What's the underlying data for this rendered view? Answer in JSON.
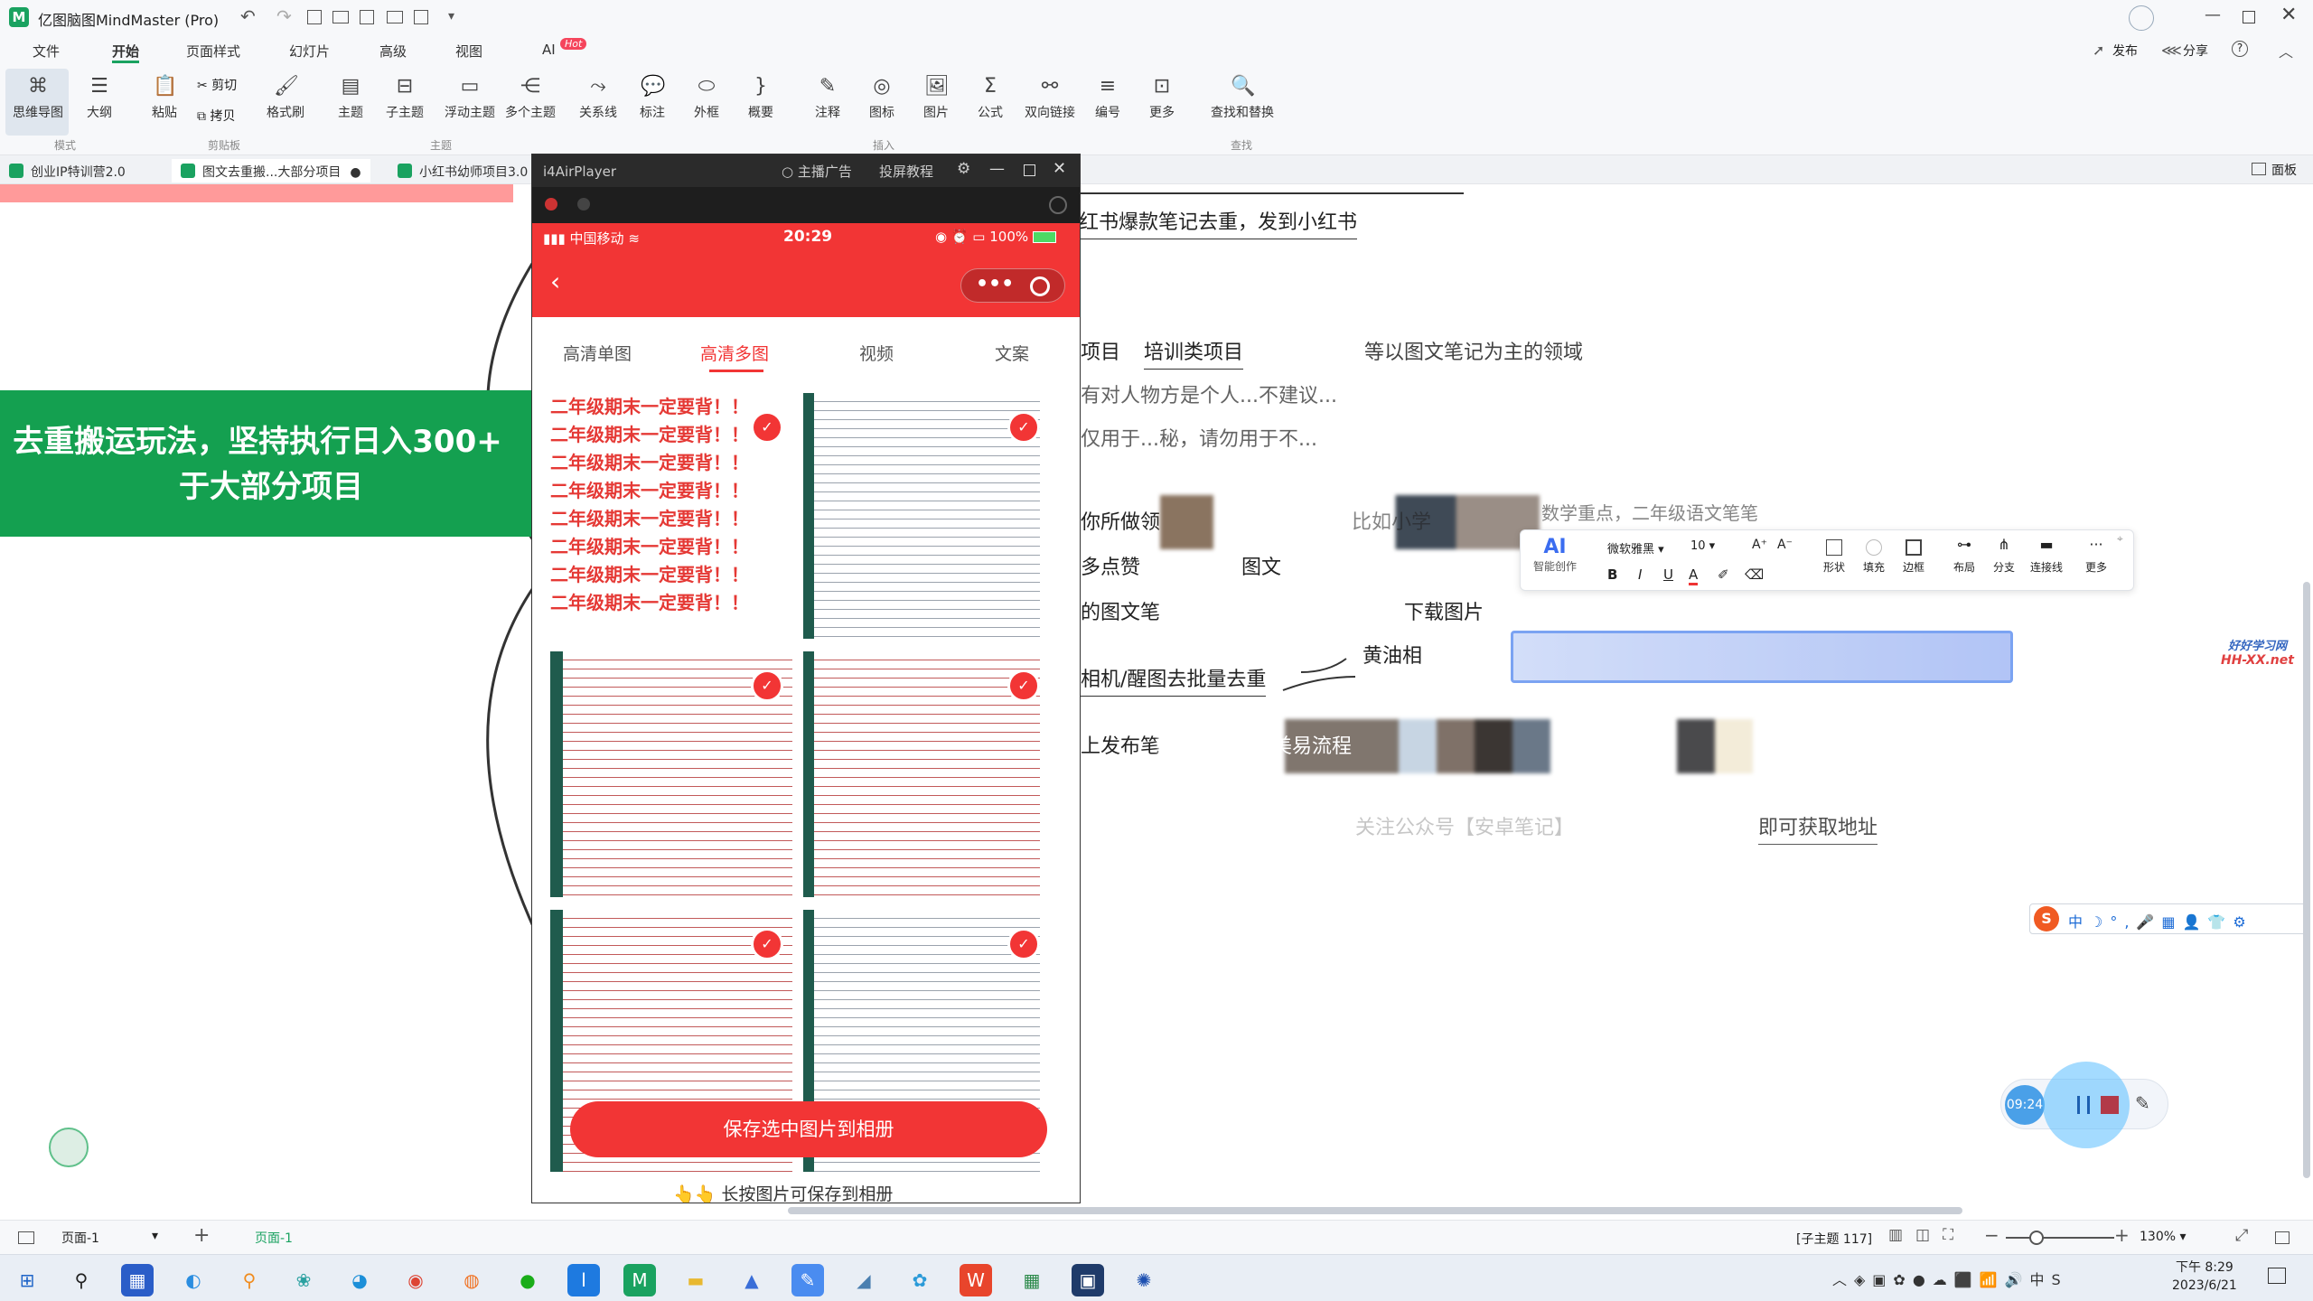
{
  "app": {
    "title": "亿图脑图MindMaster (Pro)",
    "publish": "发布",
    "share": "分享"
  },
  "menu": [
    "文件",
    "开始",
    "页面样式",
    "幻灯片",
    "高级",
    "视图",
    "AI"
  ],
  "ai_badge": "Hot",
  "ribbon": {
    "mode": [
      "思维导图",
      "大纲"
    ],
    "mode_group": "模式",
    "clip": {
      "paste": "粘贴",
      "cut": "剪切",
      "copy": "拷贝",
      "format_brush": "格式刷",
      "group": "剪贴板"
    },
    "topic": [
      "主题",
      "子主题",
      "浮动主题",
      "多个主题"
    ],
    "topic_group": "主题",
    "insert": [
      "关系线",
      "标注",
      "外框",
      "概要",
      "注释",
      "图标",
      "图片",
      "公式",
      "双向链接",
      "编号",
      "更多"
    ],
    "insert_group": "插入",
    "find": "查找和替换",
    "find_group": "查找"
  },
  "doctabs": [
    "创业IP特训营2.0",
    "图文去重搬...大部分项目",
    "小红书幼师项目3.0"
  ],
  "panel_label": "面板",
  "central_node": {
    "line1": "去重搬运玩法，坚持执行日入300+",
    "line2": "于大部分项目"
  },
  "nodes": {
    "n1": "红书爆款笔记去重，发到小红书",
    "n2a": "项目",
    "n2b": "培训类项目",
    "n2c": "等以图文笔记为主的领域",
    "n3": "有对人物方是个人...不建议...",
    "n4": "仅用于...秘，请勿用于不...",
    "n5a": "你所做领",
    "n5b": "比如小学",
    "n5c": "数学重点，二年级语文笔笔",
    "n6a": "多点赞",
    "n6b": "图文",
    "n7a": "的图文笔",
    "n7b": "下载图片",
    "n8a": "黄油相",
    "n8b": "相机/醒图去批量去重",
    "n9a": "上发布笔",
    "n9b": "美易流程",
    "n10a": "关注公众号【安卓笔记】",
    "n10b": "即可获取地址"
  },
  "float_toolbar": {
    "ai": "AI",
    "ai_label": "智能创作",
    "font": "微软雅黑",
    "size": "10",
    "shape": "形状",
    "fill": "填充",
    "border": "边框",
    "layout": "布局",
    "branch": "分支",
    "connector": "连接线",
    "more": "更多"
  },
  "watermark": {
    "line1": "好好学习网",
    "line2": "HH-XX.net"
  },
  "phone": {
    "window_title": "i4AirPlayer",
    "ad": "主播广告",
    "tutorial": "投屏教程",
    "carrier": "中国移动",
    "time": "20:29",
    "battery": "100%",
    "tabs": [
      "高清单图",
      "高清多图",
      "视频",
      "文案"
    ],
    "poster_line": "二年级期末一定要背！！",
    "save_button": "保存选中图片到相册",
    "hint": "👆👆 长按图片可保存到相册"
  },
  "recorder": {
    "time": "09:24"
  },
  "statusbar": {
    "page": "页面-1",
    "page_tab": "页面-1",
    "subtopic": "[子主题 117]",
    "zoom": "130%"
  },
  "taskbar": {
    "time": "下午 8:29",
    "date": "2023/6/21"
  }
}
